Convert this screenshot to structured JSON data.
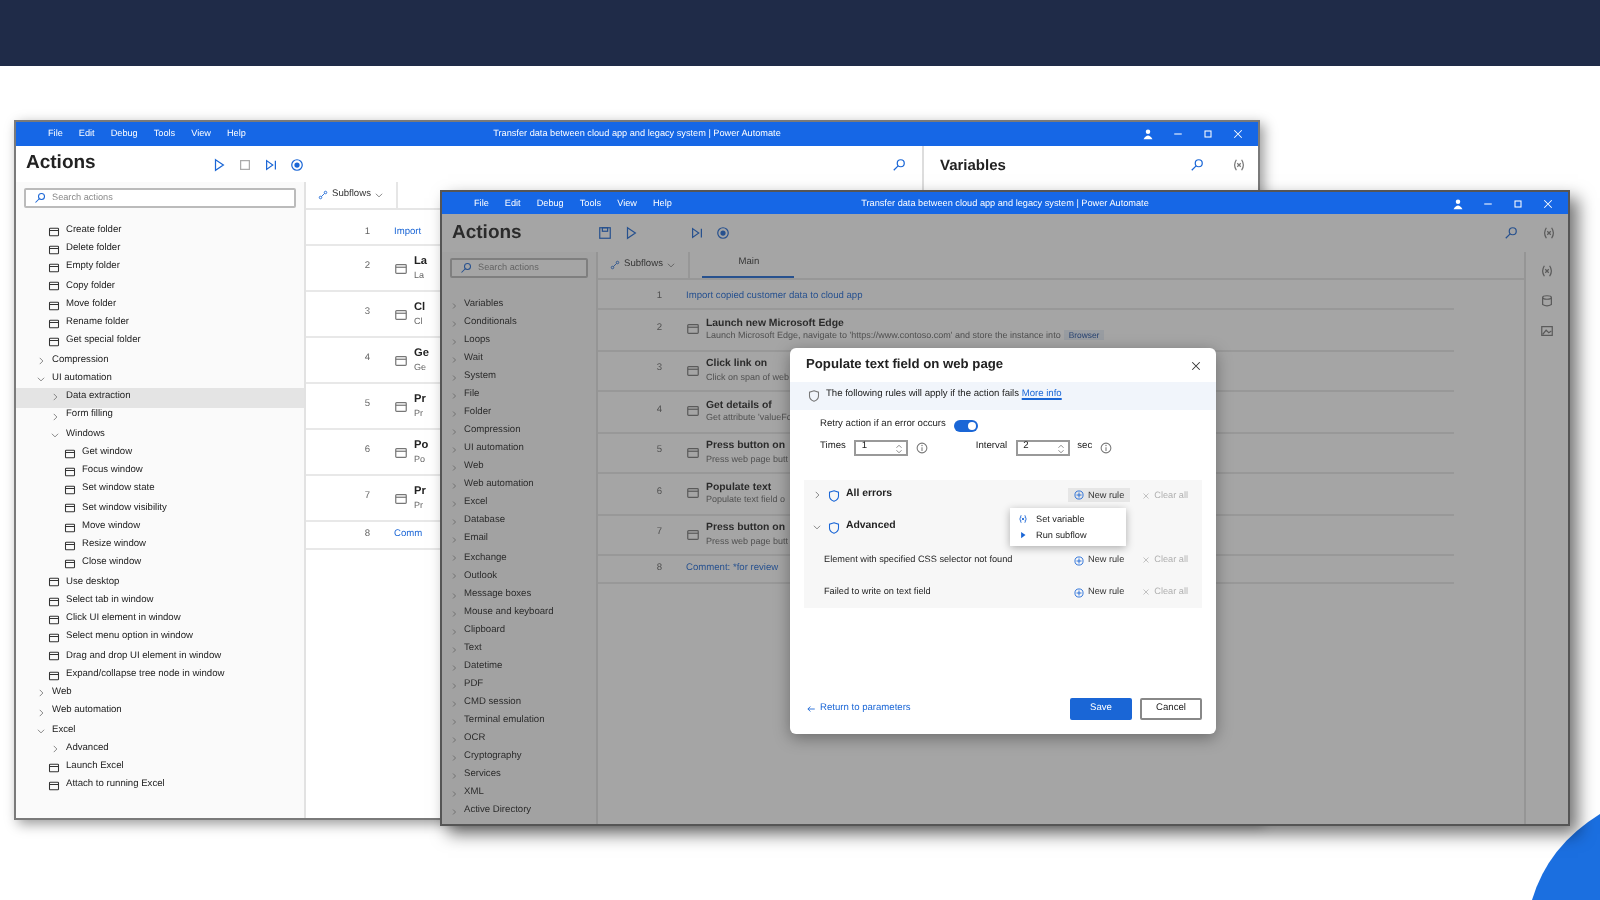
{
  "back_window": {
    "title": "Transfer data between cloud app and legacy system | Power Automate",
    "menu": [
      "File",
      "Edit",
      "Debug",
      "Tools",
      "View",
      "Help"
    ],
    "actions_title": "Actions",
    "search_placeholder": "Search actions",
    "tree": [
      {
        "label": "Create folder",
        "kind": "action",
        "selected": false
      },
      {
        "label": "Delete folder",
        "kind": "action",
        "selected": false
      },
      {
        "label": "Empty folder",
        "kind": "action",
        "selected": false
      },
      {
        "label": "Copy folder",
        "kind": "action",
        "selected": false
      },
      {
        "label": "Move folder",
        "kind": "action",
        "selected": false
      },
      {
        "label": "Rename folder",
        "kind": "action",
        "selected": false
      },
      {
        "label": "Get special folder",
        "kind": "action",
        "selected": false
      },
      {
        "label": "Compression",
        "kind": "group",
        "expanded": false,
        "selected": false
      },
      {
        "label": "UI automation",
        "kind": "group",
        "expanded": true,
        "selected": false,
        "children": [
          {
            "label": "Data extraction",
            "kind": "group",
            "expanded": false,
            "selected": true
          },
          {
            "label": "Form filling",
            "kind": "group",
            "expanded": false,
            "selected": false
          },
          {
            "label": "Windows",
            "kind": "group",
            "expanded": true,
            "selected": false,
            "children": [
              {
                "label": "Get window",
                "kind": "action",
                "selected": false
              },
              {
                "label": "Focus window",
                "kind": "action",
                "selected": false
              },
              {
                "label": "Set window state",
                "kind": "action",
                "selected": false
              },
              {
                "label": "Set window visibility",
                "kind": "action",
                "selected": false
              },
              {
                "label": "Move window",
                "kind": "action",
                "selected": false
              },
              {
                "label": "Resize window",
                "kind": "action",
                "selected": false
              },
              {
                "label": "Close window",
                "kind": "action",
                "selected": false
              }
            ]
          },
          {
            "label": "Use desktop",
            "kind": "action",
            "selected": false
          },
          {
            "label": "Select tab in window",
            "kind": "action",
            "selected": false
          },
          {
            "label": "Click UI element in window",
            "kind": "action",
            "selected": false
          },
          {
            "label": "Select menu option in window",
            "kind": "action",
            "selected": false
          },
          {
            "label": "Drag and drop UI element in window",
            "kind": "action",
            "selected": false
          },
          {
            "label": "Expand/collapse tree node in window",
            "kind": "action",
            "selected": false
          }
        ]
      },
      {
        "label": "Web",
        "kind": "group",
        "expanded": false,
        "selected": false
      },
      {
        "label": "Web automation",
        "kind": "group",
        "expanded": false,
        "selected": false
      },
      {
        "label": "Excel",
        "kind": "group",
        "expanded": true,
        "selected": false,
        "children": [
          {
            "label": "Advanced",
            "kind": "group",
            "expanded": false,
            "selected": false
          },
          {
            "label": "Launch Excel",
            "kind": "action",
            "selected": false
          },
          {
            "label": "Attach to running Excel",
            "kind": "action",
            "selected": false
          }
        ]
      }
    ],
    "subflows_tab": "Subflows",
    "flow_rows": [
      {
        "line": "1",
        "kind": "link",
        "title": "Import"
      },
      {
        "line": "2",
        "kind": "action",
        "title": "La",
        "subtitle": "La"
      },
      {
        "line": "3",
        "kind": "action",
        "title": "Cl",
        "subtitle": "Cl"
      },
      {
        "line": "4",
        "kind": "action",
        "title": "Ge",
        "subtitle": "Ge"
      },
      {
        "line": "5",
        "kind": "action",
        "title": "Pr",
        "subtitle": "Pr"
      },
      {
        "line": "6",
        "kind": "action",
        "title": "Po",
        "subtitle": "Po"
      },
      {
        "line": "7",
        "kind": "action",
        "title": "Pr",
        "subtitle": "Pr"
      },
      {
        "line": "8",
        "kind": "link",
        "title": "Comm"
      }
    ],
    "variables_title": "Variables"
  },
  "front_window": {
    "title": "Transfer data between cloud app and legacy system | Power Automate",
    "menu": [
      "File",
      "Edit",
      "Debug",
      "Tools",
      "View",
      "Help"
    ],
    "actions_title": "Actions",
    "search_placeholder": "Search actions",
    "groups": [
      "Variables",
      "Conditionals",
      "Loops",
      "Wait",
      "System",
      "File",
      "Folder",
      "Compression",
      "UI automation",
      "Web",
      "Web automation",
      "Excel",
      "Database",
      "Email",
      "Exchange",
      "Outlook",
      "Message boxes",
      "Mouse and keyboard",
      "Clipboard",
      "Text",
      "Datetime",
      "PDF",
      "CMD session",
      "Terminal emulation",
      "OCR",
      "Cryptography",
      "Services",
      "XML",
      "Active Directory"
    ],
    "subflows_tab": "Subflows",
    "tabs": [
      {
        "label": "Main",
        "selected": true
      }
    ],
    "flow_rows": [
      {
        "line": "1",
        "kind": "link",
        "title": "Import copied customer data to cloud app"
      },
      {
        "line": "2",
        "kind": "action",
        "title": "Launch new Microsoft Edge",
        "subtitle": "Launch Microsoft Edge, navigate to 'https://www.contoso.com' and store the instance into",
        "badge": "Browser"
      },
      {
        "line": "3",
        "kind": "action",
        "title": "Click link on",
        "subtitle": "Click on span of web"
      },
      {
        "line": "4",
        "kind": "action",
        "title": "Get details of",
        "subtitle": "Get attribute 'valueFo"
      },
      {
        "line": "5",
        "kind": "action",
        "title": "Press button on",
        "subtitle": "Press web page butt"
      },
      {
        "line": "6",
        "kind": "action",
        "title": "Populate text",
        "subtitle": "Populate text field o"
      },
      {
        "line": "7",
        "kind": "action",
        "title": "Press button on",
        "subtitle": "Press web page butt"
      },
      {
        "line": "8",
        "kind": "link",
        "title": "Comment: *for review"
      }
    ]
  },
  "dialog": {
    "title": "Populate text field on web page",
    "info": "The following rules will apply if the action fails",
    "info_link": "More info",
    "retry_label": "Retry action if an error occurs",
    "retry_on": true,
    "times_label": "Times",
    "times_value": "1",
    "interval_label": "Interval",
    "interval_value": "2",
    "interval_unit": "sec",
    "rules": [
      {
        "label": "All errors",
        "kind": "group",
        "expanded": false,
        "new_rule": "New rule",
        "clear_all": "Clear all",
        "clear_disabled": true,
        "hovered": true
      },
      {
        "label": "Advanced",
        "kind": "group",
        "expanded": true,
        "children": [
          {
            "label": "Element with specified CSS selector not found",
            "kind": "rule",
            "new_rule": "New rule",
            "clear_all": "Clear all",
            "clear_disabled": true,
            "hovered": false
          },
          {
            "label": "Failed to write on text field",
            "kind": "rule",
            "new_rule": "New rule",
            "clear_all": "Clear all",
            "clear_disabled": true,
            "hovered": false
          }
        ]
      }
    ],
    "menu": [
      {
        "label": "Set variable",
        "kind": "variable"
      },
      {
        "label": "Run subflow",
        "kind": "subflow"
      }
    ],
    "back_link": "Return to parameters",
    "buttons": [
      {
        "label": "Save",
        "primary": true
      },
      {
        "label": "Cancel",
        "primary": false
      }
    ]
  }
}
